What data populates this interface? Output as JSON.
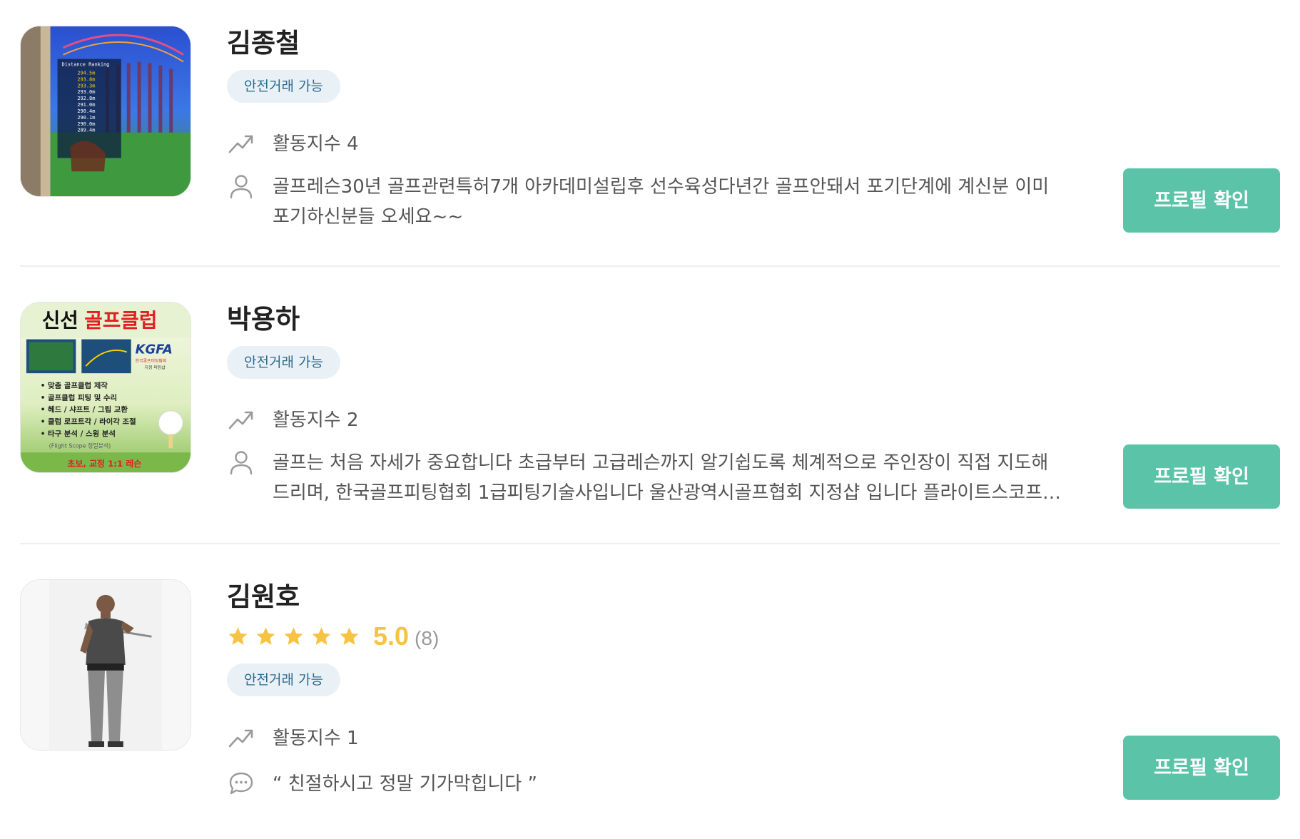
{
  "colors": {
    "accent_button": "#5bc3a8",
    "badge_bg": "#e9f1f6",
    "badge_text": "#2d6a91",
    "star": "#f6c344",
    "divider": "#eeeeee"
  },
  "icons": {
    "activity": "trending-up-icon",
    "intro": "user-icon",
    "review": "chat-bubble-icon",
    "rating": "star-icon"
  },
  "experts": [
    {
      "name": "김종철",
      "badge": "안전거래 가능",
      "activity": "활동지수 4",
      "intro": "골프레슨30년 골프관련특허7개 아카데미설립후 선수육성다년간 골프안돼서 포기단계에 계신분 이미포기하신분들 오세요~~",
      "button": "프로필 확인",
      "image": {
        "lines": [
          "Distance  Ranking",
          "294.5m",
          "293.8m",
          "293.3m",
          "293.0m",
          "292.8m",
          "291.0m",
          "290.4m",
          "290.1m",
          "290.0m",
          "289.4m"
        ]
      }
    },
    {
      "name": "박용하",
      "badge": "안전거래 가능",
      "activity": "활동지수 2",
      "intro": "골프는 처음 자세가 중요합니다 초급부터 고급레슨까지 알기쉽도록 체계적으로 주인장이 직접 지도해드리며,  한국골프피팅협회 1급피팅기술사입니다 울산광역시골프협회 지정샵 입니다 플라이트스코프 정밀분석",
      "button": "프로필 확인",
      "image": {
        "title_a": "신선",
        "title_b": "골프클럽",
        "logo": "KGFA",
        "logo_sub1": "한국골프피팅협회",
        "logo_sub2": "지정 피팅샵",
        "bullets": [
          "• 맞춤 골프클럽 제작",
          "• 골프클럽 피팅 및 수리",
          "• 헤드 / 샤프트 / 그립 교환",
          "• 클럽 로프트각 / 라이각 조절",
          "• 타구 분석 / 스윙 분석"
        ],
        "scope": "(Flight Scope 정밀분석)",
        "footer": "초보, 교정 1:1 레슨"
      }
    },
    {
      "name": "김원호",
      "rating": {
        "value": "5.0",
        "count": "(8)",
        "stars": 5
      },
      "badge": "안전거래 가능",
      "activity": "활동지수 1",
      "review": "“ 친절하시고 정말 기가막힙니다 ”",
      "button": "프로필 확인"
    }
  ]
}
